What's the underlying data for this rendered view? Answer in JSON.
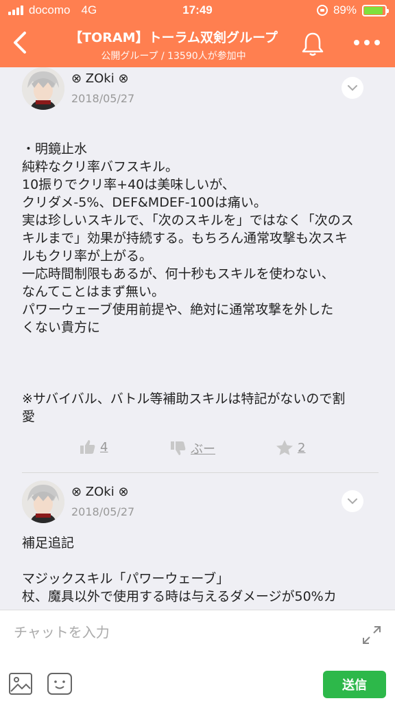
{
  "status_bar": {
    "carrier": "docomo",
    "network": "4G",
    "time": "17:49",
    "battery_percent": "89%",
    "battery_level": 0.89
  },
  "nav": {
    "title": "【TORAM】トーラム双剣グループ",
    "subtitle": "公開グループ / 13590人が参加中"
  },
  "posts": [
    {
      "author": "⊗ ZOki ⊗",
      "date": "2018/05/27",
      "lines": [
        "・明鏡止水",
        "純粋なクリ率バフスキル。",
        "10振りでクリ率+40は美味しいが、",
        "クリダメ-5%、DEF&MDEF-100は痛い。",
        "実は珍しいスキルで、「次のスキルを」ではなく「次のス",
        "キルまで」効果が持続する。もちろん通常攻撃も次スキ",
        "ルもクリ率が上がる。",
        "一応時間制限もあるが、何十秒もスキルを使わない、",
        "なんてことはまず無い。",
        "パワーウェーブ使用前提や、絶対に通常攻撃を外した",
        "くない貴方に",
        "",
        "",
        "",
        "※サバイバル、バトル等補助スキルは特記がないので割",
        "愛"
      ],
      "likes": "4",
      "boo": "ぶー",
      "stars": "2"
    },
    {
      "author": "⊗ ZOki ⊗",
      "date": "2018/05/27",
      "lines": [
        "補足追記",
        "",
        "マジックスキル「パワーウェーブ」",
        "杖、魔具以外で使用する時は与えるダメージが50%カ"
      ]
    }
  ],
  "composer": {
    "placeholder": "チャットを入力",
    "send_label": "送信"
  },
  "colors": {
    "header": "#ff7f50",
    "send": "#2db84a"
  }
}
